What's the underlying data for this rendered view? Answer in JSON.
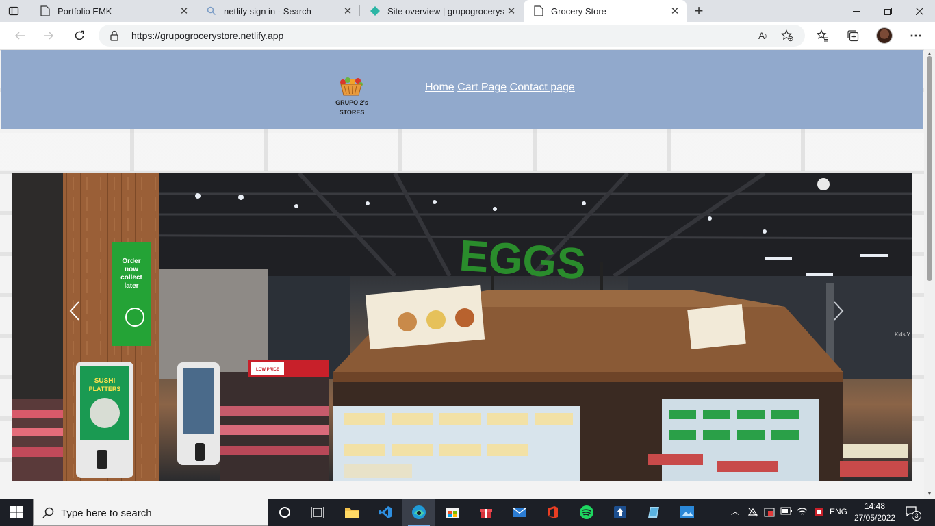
{
  "browser": {
    "tabs": [
      {
        "title": "Portfolio EMK",
        "active": false
      },
      {
        "title": "netlify sign in - Search",
        "active": false
      },
      {
        "title": "Site overview | grupogrocerystor",
        "active": false
      },
      {
        "title": "Grocery Store",
        "active": true
      }
    ],
    "url": "https://grupogrocerystore.netlify.app"
  },
  "site": {
    "logo_line1": "GRUPO 2's",
    "logo_line2": "STORES",
    "nav": {
      "home": "Home",
      "cart": "Cart Page",
      "contact": "Contact page"
    },
    "carousel": {
      "sign_eggs": "EGGS",
      "sign_order": "Order now collect later",
      "kiosk_text": "SUSHI PLATTERS",
      "price_sign": "LOW PRICE ALWAYS",
      "right_text": "Kids Y"
    }
  },
  "taskbar": {
    "search_placeholder": "Type here to search",
    "language": "ENG",
    "time": "14:48",
    "date": "27/05/2022",
    "notification_count": "3"
  }
}
